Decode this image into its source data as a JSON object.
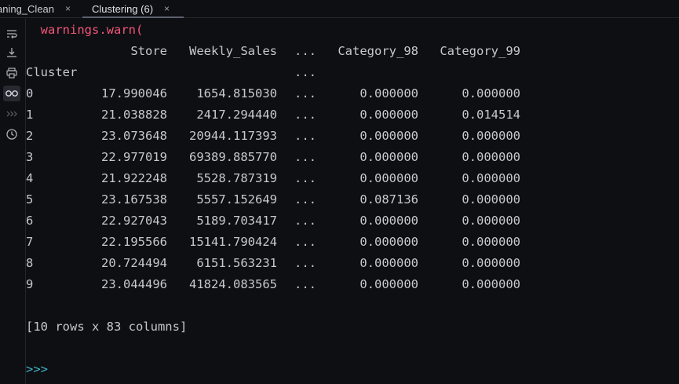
{
  "tabs": [
    {
      "label": "aning_Clean",
      "close": "×"
    },
    {
      "label": "Clustering (6)",
      "close": "×"
    }
  ],
  "console": {
    "warning_line": "  warnings.warn(",
    "header": [
      "Store",
      "Weekly_Sales",
      "...",
      "Category_98",
      "Category_99"
    ],
    "index_name": "Cluster",
    "index_ellipsis": "...",
    "rows": [
      [
        "0",
        "17.990046",
        "1654.815030",
        "...",
        "0.000000",
        "0.000000"
      ],
      [
        "1",
        "21.038828",
        "2417.294440",
        "...",
        "0.000000",
        "0.014514"
      ],
      [
        "2",
        "23.073648",
        "20944.117393",
        "...",
        "0.000000",
        "0.000000"
      ],
      [
        "3",
        "22.977019",
        "69389.885770",
        "...",
        "0.000000",
        "0.000000"
      ],
      [
        "4",
        "21.922248",
        "5528.787319",
        "...",
        "0.000000",
        "0.000000"
      ],
      [
        "5",
        "23.167538",
        "5557.152649",
        "...",
        "0.087136",
        "0.000000"
      ],
      [
        "6",
        "22.927043",
        "5189.703417",
        "...",
        "0.000000",
        "0.000000"
      ],
      [
        "7",
        "22.195566",
        "15141.790424",
        "...",
        "0.000000",
        "0.000000"
      ],
      [
        "8",
        "20.724494",
        "6151.563231",
        "...",
        "0.000000",
        "0.000000"
      ],
      [
        "9",
        "23.044496",
        "41824.083565",
        "...",
        "0.000000",
        "0.000000"
      ]
    ],
    "summary": "[10 rows x 83 columns]",
    "prompt": ">>>"
  },
  "gutter_icons": [
    "soft-wrap-icon",
    "scroll-to-end-icon",
    "print-icon",
    "show-variables-icon",
    "history-chevrons-icon",
    "history-clock-icon"
  ],
  "colors": {
    "background": "#0e0f12",
    "text": "#c5c8ce",
    "warning": "#f1557a",
    "prompt": "#3fb4c9"
  }
}
